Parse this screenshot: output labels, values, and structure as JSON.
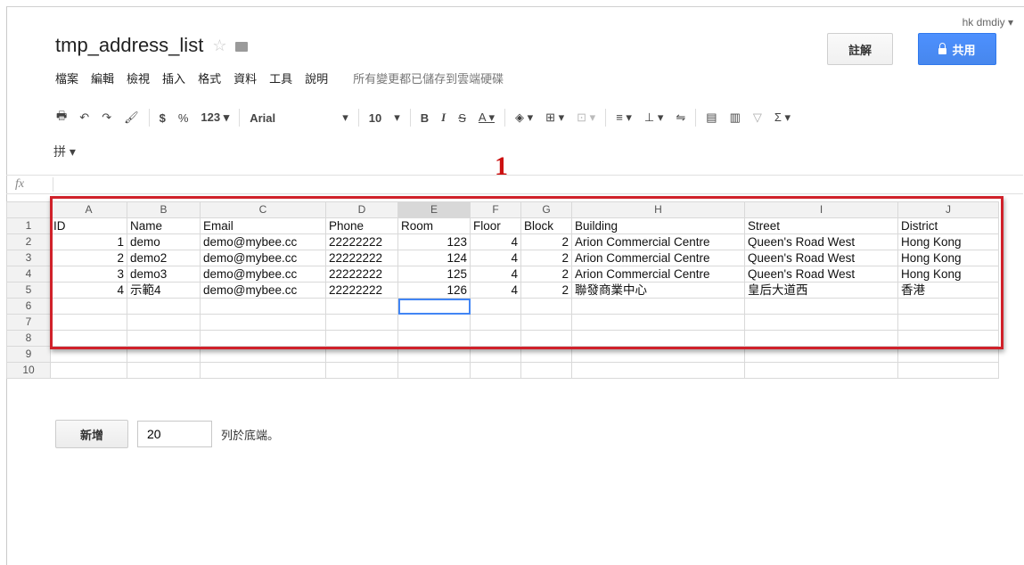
{
  "user": "hk dmdiy ▾",
  "doc": {
    "title": "tmp_address_list",
    "star": "☆"
  },
  "menu": [
    "檔案",
    "編輯",
    "檢視",
    "插入",
    "格式",
    "資料",
    "工具",
    "說明"
  ],
  "save_status": "所有變更都已儲存到雲端硬碟",
  "buttons": {
    "comment": "註解",
    "share": "共用"
  },
  "toolbar": {
    "print": "🖶",
    "undo": "↶",
    "redo": "↷",
    "paint_format": "🖌",
    "currency": "$",
    "percent": "%",
    "number_format": "123 ▾",
    "font": "Arial",
    "font_dropdown": "▾",
    "font_size": "10",
    "size_dropdown": "▾",
    "bold": "B",
    "italic": "I",
    "strike": "S",
    "text_color": "A ▾",
    "fill_color": "◈ ▾",
    "borders": "⊞ ▾",
    "merge": "⊡ ▾",
    "align": "≡ ▾",
    "valign": "⊥ ▾",
    "wrap": "⇋",
    "comment": "▤",
    "chart": "▥",
    "filter": "▽",
    "functions": "Σ ▾",
    "input_tools": "拼 ▾"
  },
  "formula": {
    "fx": "fx"
  },
  "marker": "1",
  "sheet": {
    "columns": [
      "A",
      "B",
      "C",
      "D",
      "E",
      "F",
      "G",
      "H",
      "I",
      "J"
    ],
    "rows": [
      [
        "ID",
        "Name",
        "Email",
        "Phone",
        "Room",
        "Floor",
        "Block",
        "Building",
        "Street",
        "District"
      ],
      [
        "1",
        "demo",
        "demo@mybee.cc",
        "22222222",
        "123",
        "4",
        "2",
        "Arion Commercial Centre",
        "Queen's Road West",
        "Hong Kong"
      ],
      [
        "2",
        "demo2",
        "demo@mybee.cc",
        "22222222",
        "124",
        "4",
        "2",
        "Arion Commercial Centre",
        "Queen's Road West",
        "Hong Kong"
      ],
      [
        "3",
        "demo3",
        "demo@mybee.cc",
        "22222222",
        "125",
        "4",
        "2",
        "Arion Commercial Centre",
        "Queen's Road West",
        "Hong Kong"
      ],
      [
        "4",
        "示範4",
        "demo@mybee.cc",
        "22222222",
        "126",
        "4",
        "2",
        "聯發商業中心",
        "皇后大道西",
        "香港"
      ],
      [
        "",
        "",
        "",
        "",
        "",
        "",
        "",
        "",
        "",
        ""
      ],
      [
        "",
        "",
        "",
        "",
        "",
        "",
        "",
        "",
        "",
        ""
      ],
      [
        "",
        "",
        "",
        "",
        "",
        "",
        "",
        "",
        "",
        ""
      ],
      [
        "",
        "",
        "",
        "",
        "",
        "",
        "",
        "",
        "",
        ""
      ],
      [
        "",
        "",
        "",
        "",
        "",
        "",
        "",
        "",
        "",
        ""
      ]
    ],
    "row_numbers": [
      "1",
      "2",
      "3",
      "4",
      "5",
      "6",
      "7",
      "8",
      "9",
      "10"
    ],
    "selected_column": "E",
    "selected_cell": "E6"
  },
  "add_rows": {
    "button": "新增",
    "count": "20",
    "suffix": "列於底端。"
  }
}
